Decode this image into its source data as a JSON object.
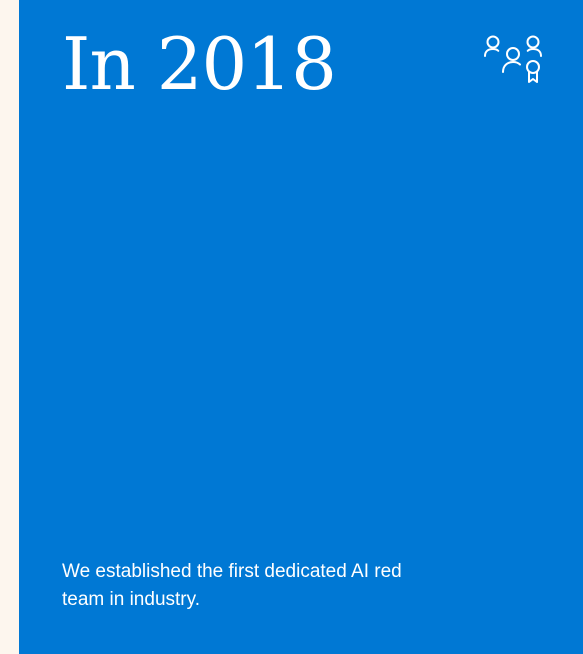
{
  "card": {
    "headline": "In 2018",
    "icon": "people-award-icon",
    "body": "We established the first dedicated AI red team in industry.",
    "background_color": "#0078d4",
    "text_color": "#ffffff"
  },
  "page": {
    "background_color": "#fdf6ee"
  }
}
